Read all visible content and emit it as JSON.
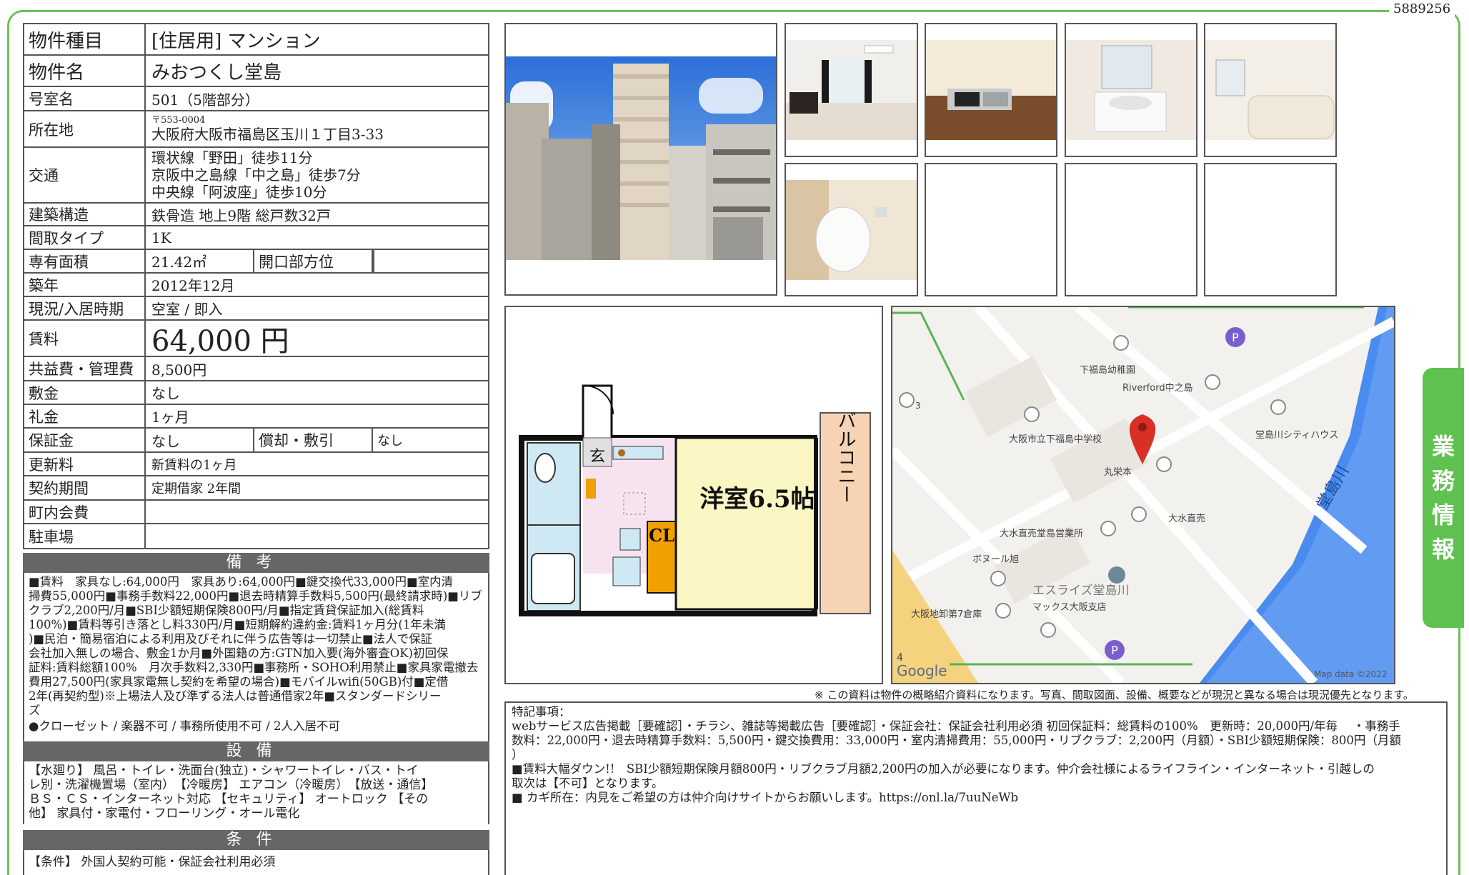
{
  "doc_id": "5889256",
  "side_tab": [
    "業",
    "務",
    "情",
    "報"
  ],
  "property": {
    "type_label": "物件種目",
    "type_value": "[住居用]  マンション",
    "name_label": "物件名",
    "name_value": "みおつくし堂島",
    "room_label": "号室名",
    "room_value": "501（5階部分）",
    "address_label": "所在地",
    "postal": "〒553-0004",
    "address": "大阪府大阪市福島区玉川１丁目3-33",
    "access_label": "交通",
    "access": [
      "環状線「野田」徒歩11分",
      "京阪中之島線「中之島」徒歩7分",
      "中央線「阿波座」徒歩10分"
    ],
    "structure_label": "建築構造",
    "structure_value": "鉄骨造 地上9階 総戸数32戸",
    "layout_label": "間取タイプ",
    "layout_value": "1K",
    "area_label": "専有面積",
    "area_value": "21.42㎡",
    "direction_label": "開口部方位",
    "direction_value": "",
    "built_label": "築年",
    "built_value": "2012年12月",
    "status_label": "現況/入居時期",
    "status_value": "空室 / 即入",
    "rent_label": "賃料",
    "rent_value": "64,000 円",
    "fee_label": "共益費・管理費",
    "fee_value": "8,500円",
    "deposit_label": "敷金",
    "deposit_value": "なし",
    "keymoney_label": "礼金",
    "keymoney_value": "1ヶ月",
    "guarantee_label": "保証金",
    "guarantee_value": "なし",
    "amort_label": "償却・敷引",
    "amort_value": "なし",
    "renewal_label": "更新料",
    "renewal_value": "新賃料の1ヶ月",
    "contract_label": "契約期間",
    "contract_value": "定期借家 2年間",
    "community_label": "町内会費",
    "community_value": "",
    "parking_label": "駐車場",
    "parking_value": ""
  },
  "remarks": {
    "title": "備考",
    "lines": [
      "■賃料　家具なし:64,000円　家具あり:64,000円■鍵交換代33,000円■室内清",
      "掃費55,000円■事務手数料22,000円■退去時精算手数料5,500円(最終請求時)■リブ",
      "クラブ2,200円/月■SBI少額短期保険800円/月■指定賃貸保証加入(総賃料",
      "100%)■賃料等引き落とし料330円/月■短期解約違約金:賃料1ヶ月分(1年未満",
      ")■民泊・簡易宿泊による利用及びそれに伴う広告等は一切禁止■法人で保証",
      "会社加入無しの場合、敷金1か月■外国籍の方:GTN加入要(海外審査OK)初回保",
      "証料:賃料総額100%　月次手数料2,330円■事務所・SOHO利用禁止■家具家電撤去",
      "費用27,500円(家具家電無し契約を希望の場合)■モバイルwifi(50GB)付■定借",
      "2年(再契約型)※上場法人及び準ずる法人は普通借家2年■スタンダードシリー",
      "ズ"
    ],
    "extra": "●クローゼット / 楽器不可 / 事務所使用不可 / 2人入居不可"
  },
  "equipment": {
    "title": "設備",
    "lines": [
      "【水廻り】 風呂・トイレ・洗面台(独立)・シャワートイレ・バス・トイ",
      "レ別・洗濯機置場（室内）　【冷暖房】 エアコン（冷暖房）　【放送・通信】",
      "ＢＳ・ＣＳ・インターネット対応 【セキュリティ】 オートロック 【その",
      "他】 家具付・家電付・フローリング・オール電化"
    ]
  },
  "conditions": {
    "title": "条件",
    "text": "【条件】 外国人契約可能・保証会社利用必須"
  },
  "floorplan": {
    "room_label": "洋室6.5帖",
    "balcony_label": "バルコニー",
    "closet_label": "CL",
    "entrance_label": "玄"
  },
  "map": {
    "labels": [
      "下福島幼稚園",
      "Riverford中之島",
      "大阪市立下福島中学校",
      "堂島川シティハウス",
      "丸栄本",
      "大水直売",
      "大水直売堂島営業所",
      "ボヌール旭",
      "エスライズ堂島川",
      "マックス大阪支店",
      "大阪地卸第7倉庫",
      "堂島川"
    ],
    "google": "Google",
    "attribution": "Map data ©2022",
    "num3": "3",
    "num4": "4"
  },
  "notice": "※ この資料は物件の概略紹介資料になります。写真、間取図面、設備、概要などが現況と異なる場合は現況優先となります。",
  "special": {
    "title": "特記事項：",
    "lines": [
      "webサービス広告掲載［要確認］・チラシ、雑誌等掲載広告［要確認］・保証会社：保証会社利用必須 初回保証料：総賃料の100%　更新時：20,000円/年毎 　・事務手",
      "数料：22,000円・退去時精算手数料：5,500円・鍵交換費用：33,000円・室内清掃費用：55,000円・リブクラブ：2,200円（月額）・SBI少額短期保険：800円（月額",
      "）",
      "■賃料大幅ダウン!!　SBI少額短期保険月額800円・リブクラブ月額2,200円の加入が必要になります。仲介会社様によるライフライン・インターネット・引越しの",
      "取次は【不可】となります。",
      "■ カギ所在：内見をご希望の方は仲介向けサイトからお願いします。https://onl.la/7uuNeWb"
    ]
  },
  "colors": {
    "frame": "#6ac259",
    "tab": "#5fc14f",
    "section": "#666666",
    "map_water": "#4a8bef",
    "pin": "#d93025"
  }
}
